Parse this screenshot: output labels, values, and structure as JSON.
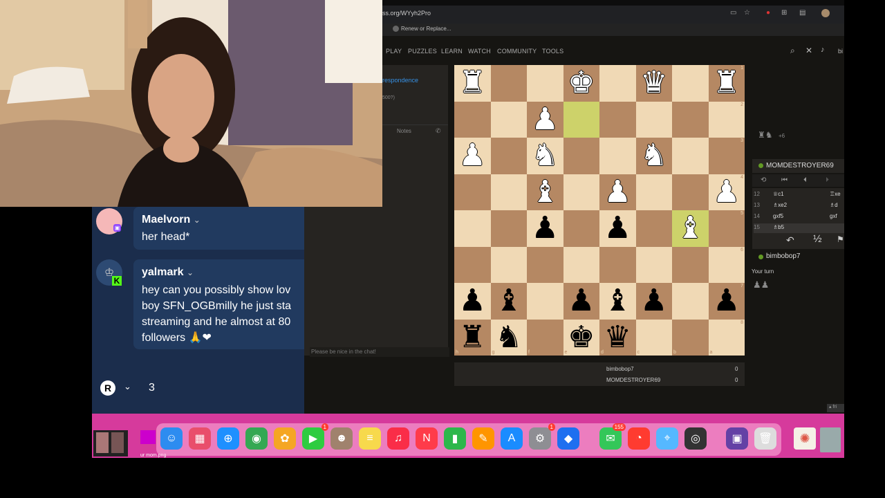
{
  "browser": {
    "url": "ss.org/WYyh2Pro",
    "bookmark": "Renew or Replace..."
  },
  "nav": [
    "PLAY",
    "PUZZLES",
    "LEARN",
    "WATCH",
    "COMMUNITY",
    "TOOLS"
  ],
  "header_user_snip": "bi",
  "left_panel": {
    "correspondence": "respondence",
    "rating_snip": "500?)",
    "notes_tab": "Notes",
    "chat_placeholder": "Please be nice in the chat!"
  },
  "board": {
    "ranks": [
      "1",
      "2",
      "3",
      "4",
      "5",
      "6",
      "7",
      "8"
    ],
    "files": [
      "h",
      "g",
      "f",
      "e",
      "d",
      "c",
      "b",
      "a"
    ],
    "rows": [
      [
        "wR",
        "",
        "",
        "wK",
        "",
        "wQ",
        "",
        "wR"
      ],
      [
        "",
        "",
        "wP",
        "",
        "",
        "",
        "",
        ""
      ],
      [
        "wP",
        "",
        "wN",
        "",
        "",
        "wN",
        "",
        ""
      ],
      [
        "",
        "",
        "wB",
        "",
        "wP",
        "",
        "",
        "wP"
      ],
      [
        "",
        "",
        "bP",
        "",
        "bP",
        "",
        "wB",
        ""
      ],
      [
        "",
        "",
        "",
        "",
        "",
        "",
        "",
        ""
      ],
      [
        "bP",
        "bB",
        "",
        "bP",
        "bB",
        "bP",
        "",
        "bP"
      ],
      [
        "bR",
        "bN",
        "",
        "bK",
        "bQ",
        "",
        "",
        ""
      ]
    ],
    "highlights": [
      "1,3",
      "4,6"
    ]
  },
  "scores": [
    {
      "name": "bimbobop7",
      "score": "0"
    },
    {
      "name": "MOMDESTROYER69",
      "score": "0"
    }
  ],
  "right_panel": {
    "captured": "♜♞",
    "captured_count": "+6",
    "opponent": "MOMDESTROYER69",
    "moves": [
      {
        "num": "12",
        "white": "♕c1",
        "black": "♖xe"
      },
      {
        "num": "13",
        "white": "♗xe2",
        "black": "♗d"
      },
      {
        "num": "14",
        "white": "gxf5",
        "black": "gxf"
      },
      {
        "num": "15",
        "white": "♗b5",
        "black": ""
      }
    ],
    "draw_label": "½",
    "me": "bimbobop7",
    "your_turn": "Your turn",
    "bottom_chip": "fri"
  },
  "chat": {
    "messages": [
      {
        "user": "Maelvorn",
        "text": [
          "her head*"
        ]
      },
      {
        "user": "yalmark",
        "text": [
          "hey can you possibly show lov",
          "boy SFN_OGBmilly he just sta",
          "streaming and he almost at 80",
          "followers 🙏❤"
        ]
      }
    ],
    "footer_letter": "R",
    "footer_count": "3"
  },
  "dock": {
    "items": [
      {
        "name": "finder-icon",
        "glyph": "☺",
        "color": "#2d8cf0"
      },
      {
        "name": "launchpad-icon",
        "glyph": "▦",
        "color": "#e94e6b"
      },
      {
        "name": "safari-icon",
        "glyph": "⊕",
        "color": "#1e90ff"
      },
      {
        "name": "chrome-icon",
        "glyph": "◉",
        "color": "#34a853"
      },
      {
        "name": "photos-icon",
        "glyph": "✿",
        "color": "#f5a623"
      },
      {
        "name": "facetime-icon",
        "glyph": "▶",
        "color": "#2ecc40",
        "badge": "1"
      },
      {
        "name": "contacts-icon",
        "glyph": "☻",
        "color": "#a0826d"
      },
      {
        "name": "notes-icon",
        "glyph": "≡",
        "color": "#f7d94c"
      },
      {
        "name": "music-icon",
        "glyph": "♫",
        "color": "#fa2d48"
      },
      {
        "name": "news-icon",
        "glyph": "N",
        "color": "#ff3b4a"
      },
      {
        "name": "numbers-icon",
        "glyph": "▮",
        "color": "#2db74b"
      },
      {
        "name": "pages-icon",
        "glyph": "✎",
        "color": "#ff9500"
      },
      {
        "name": "app-store-icon",
        "glyph": "A",
        "color": "#1a8cff"
      },
      {
        "name": "system-settings-icon",
        "glyph": "⚙",
        "color": "#8e8e93",
        "badge": "1"
      },
      {
        "name": "roblox-icon",
        "glyph": "◆",
        "color": "#1e6ff0"
      },
      {
        "name": "messages-icon",
        "glyph": "✉",
        "color": "#34c759",
        "badge": "155"
      },
      {
        "name": "spotify-icon",
        "glyph": "◔",
        "color": "#ff3b30"
      },
      {
        "name": "maps-icon",
        "glyph": "⌖",
        "color": "#55b8ff"
      },
      {
        "name": "obs-icon",
        "glyph": "◎",
        "color": "#333333"
      },
      {
        "name": "twitch-icon",
        "glyph": "▣",
        "color": "#6441a5"
      },
      {
        "name": "trash-icon",
        "glyph": "🗑",
        "color": "#dddddd"
      }
    ],
    "recent_label": "ur mom.png"
  }
}
